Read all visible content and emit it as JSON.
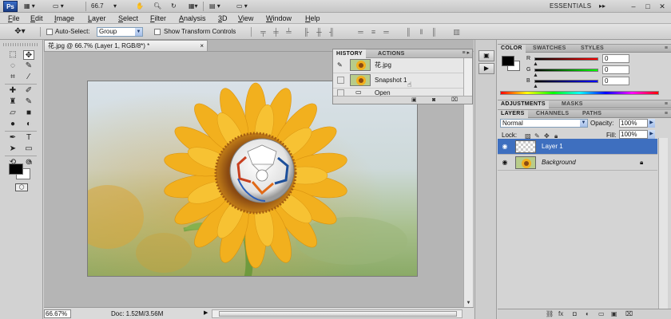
{
  "titlebar": {
    "app_logo": "Ps",
    "zoom_value": "66.7",
    "workspace": "ESSENTIALS",
    "win_minimize": "–",
    "win_restore": "□",
    "win_close": "✕"
  },
  "menu": {
    "items": [
      "File",
      "Edit",
      "Image",
      "Layer",
      "Select",
      "Filter",
      "Analysis",
      "3D",
      "View",
      "Window",
      "Help"
    ]
  },
  "options": {
    "auto_select_label": "Auto-Select:",
    "auto_select_value": "Group",
    "show_transform_label": "Show Transform Controls"
  },
  "document": {
    "tab_title": "花.jpg @ 66.7% (Layer 1, RGB/8*) *",
    "tab_close": "×",
    "zoom_percent": "66.67%",
    "doc_size": "Doc: 1.52M/3.56M"
  },
  "history": {
    "tabs": [
      "HISTORY",
      "ACTIONS"
    ],
    "active_tab": "HISTORY",
    "items": [
      {
        "label": "花.jpg"
      },
      {
        "label": "Snapshot 1"
      },
      {
        "label": "Open"
      }
    ]
  },
  "color_panel": {
    "tabs": [
      "COLOR",
      "SWATCHES",
      "STYLES"
    ],
    "sliders": [
      {
        "label": "R",
        "value": "0",
        "gradient": [
          "#000000",
          "#ff0000"
        ]
      },
      {
        "label": "G",
        "value": "0",
        "gradient": [
          "#000000",
          "#00ff00"
        ]
      },
      {
        "label": "B",
        "value": "0",
        "gradient": [
          "#000000",
          "#0000ff"
        ]
      }
    ]
  },
  "adjustments": {
    "tabs": [
      "ADJUSTMENTS",
      "MASKS"
    ]
  },
  "layers_panel": {
    "tabs": [
      "LAYERS",
      "CHANNELS",
      "PATHS"
    ],
    "blend_mode": "Normal",
    "opacity_label": "Opacity:",
    "opacity_value": "100%",
    "lock_label": "Lock:",
    "fill_label": "Fill:",
    "fill_value": "100%",
    "layers": [
      {
        "name": "Layer 1",
        "selected": true
      },
      {
        "name": "Background",
        "selected": false
      }
    ],
    "footer_icons": [
      "link-icon",
      "fx-icon",
      "mask-icon",
      "adjustment-icon",
      "group-icon",
      "new-layer-icon",
      "trash-icon"
    ]
  },
  "colors": {
    "selection_blue": "#3e6fbf",
    "petal_yellow": "#f2b01e",
    "flower_center": "#8a4a12"
  }
}
